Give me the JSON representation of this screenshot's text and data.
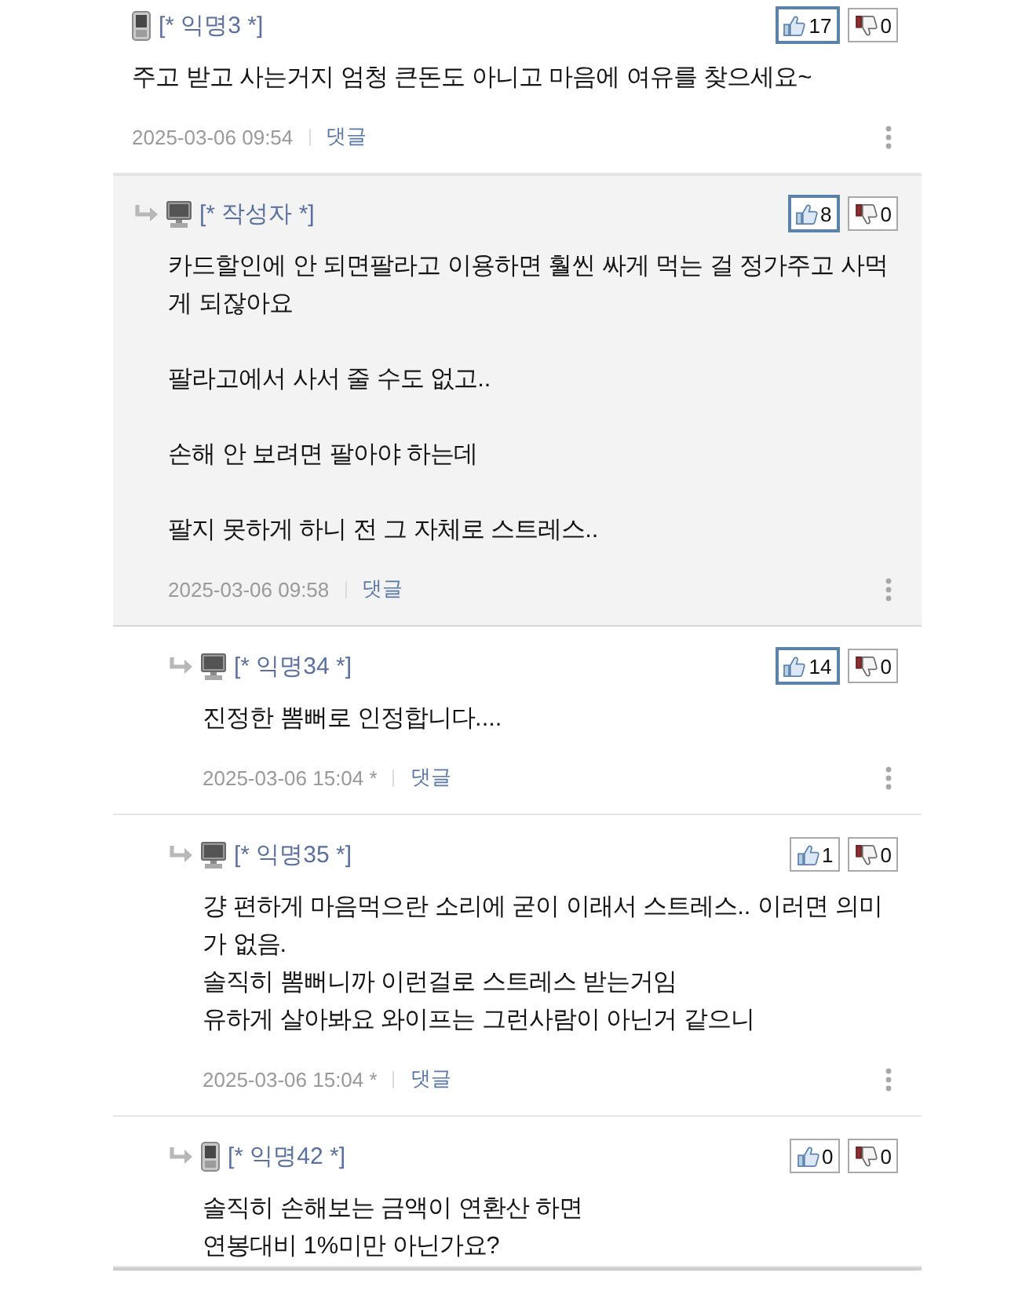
{
  "comments": [
    {
      "author": "[* 익명3 *]",
      "kind": "mobile",
      "by_writer": false,
      "likes": {
        "count": "17",
        "highlighted": true
      },
      "dislikes": {
        "count": "0"
      },
      "text": "주고 받고 사는거지 엄청 큰돈도 아니고 마음에 여유를 찾으세요~",
      "date": "2025-03-06 09:54",
      "reply_label": "댓글",
      "children": [
        {
          "author": "[* 작성자 *]",
          "kind": "pc",
          "by_writer": true,
          "likes": {
            "count": "8",
            "highlighted": true
          },
          "dislikes": {
            "count": "0"
          },
          "text": "카드할인에 안 되면팔라고 이용하면 훨씬 싸게 먹는 걸 정가주고 사먹게 되잖아요\n\n팔라고에서 사서 줄 수도 없고..\n\n손해 안 보려면 팔아야 하는데\n\n팔지 못하게 하니 전 그 자체로 스트레스..",
          "date": "2025-03-06 09:58",
          "reply_label": "댓글",
          "children": [
            {
              "author": "[* 익명34 *]",
              "kind": "pc",
              "by_writer": false,
              "likes": {
                "count": "14",
                "highlighted": true
              },
              "dislikes": {
                "count": "0"
              },
              "text": "진정한 뽐뻐로 인정합니다....",
              "date": "2025-03-06 15:04 *",
              "reply_label": "댓글"
            },
            {
              "author": "[* 익명35 *]",
              "kind": "pc",
              "by_writer": false,
              "likes": {
                "count": "1",
                "highlighted": false
              },
              "dislikes": {
                "count": "0"
              },
              "text": "걍 편하게 마음먹으란 소리에 굳이 이래서 스트레스.. 이러면 의미가 없음.\n솔직히 뽐뻐니까 이런걸로 스트레스 받는거임\n유하게 살아봐요 와이프는 그런사람이 아닌거 같으니",
              "date": "2025-03-06 15:04 *",
              "reply_label": "댓글"
            },
            {
              "author": "[* 익명42 *]",
              "kind": "mobile",
              "by_writer": false,
              "likes": {
                "count": "0",
                "highlighted": false
              },
              "dislikes": {
                "count": "0"
              },
              "text": "솔직히 손해보는 금액이 연환산 하면\n연봉대비 1%미만 아닌가요?"
            }
          ]
        }
      ]
    }
  ]
}
